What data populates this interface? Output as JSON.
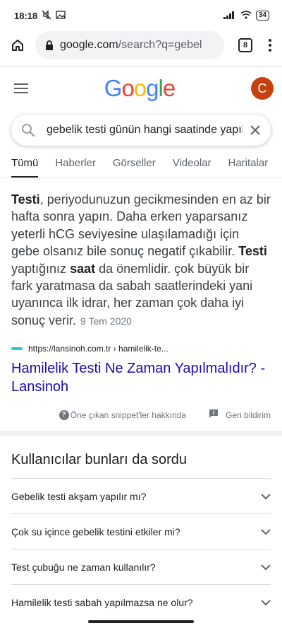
{
  "status": {
    "time": "18:18",
    "battery": "34"
  },
  "browser": {
    "url_host": "google.com",
    "url_path": "/search?q=gebel",
    "tab_count": "8"
  },
  "header": {
    "logo_letters": [
      "G",
      "o",
      "o",
      "g",
      "l",
      "e"
    ],
    "logo_colors": [
      "#4285F4",
      "#EA4335",
      "#FBBC05",
      "#4285F4",
      "#34A853",
      "#EA4335"
    ],
    "avatar_letter": "C"
  },
  "search": {
    "query": "gebelik testi günün hangi saatinde yapılır"
  },
  "tabs": [
    "Tümü",
    "Haberler",
    "Görseller",
    "Videolar",
    "Haritalar"
  ],
  "snippet": {
    "t1_b": "Testi",
    "t1": ", periyodunuzun gecikmesinden en az bir hafta sonra yapın. Daha erken yaparsanız yeterli hCG seviyesine ulaşılamadığı için gebe olsanız bile sonuç negatif çıkabilir. ",
    "t2_b": "Testi",
    "t2": " yaptığınız ",
    "t3_b": "saat",
    "t3": " da önemlidir. çok büyük bir fark yaratmasa da sabah saatlerindeki yani uyanınca ilk idrar, her zaman çok daha iyi sonuç verir.",
    "date": "9 Tem 2020",
    "source_url": "https://lansinoh.com.tr › hamilelik-te...",
    "title": "Hamilelik Testi Ne Zaman Yapılmalıdır? - Lansinoh",
    "about_label": "Öne çıkan snippet'ler hakkında",
    "feedback_label": "Geri bildirim"
  },
  "paa": {
    "title": "Kullanıcılar bunları da sordu",
    "questions": [
      "Gebelik testi akşam yapılır mı?",
      "Çok su içince gebelik testini etkiler mi?",
      "Test çubuğu ne zaman kullanılır?",
      "Hamilelik testi sabah yapılmazsa ne olur?"
    ]
  }
}
